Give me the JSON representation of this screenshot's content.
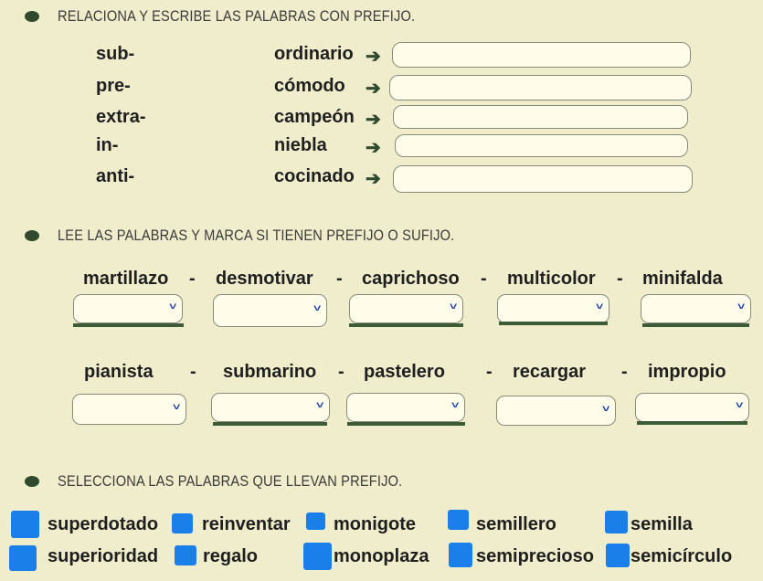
{
  "section1": {
    "heading": "RELACIONA Y ESCRIBE LAS PALABRAS CON PREFIJO.",
    "prefixes": [
      "sub-",
      "pre-",
      "extra-",
      "in-",
      "anti-"
    ],
    "words": [
      "ordinario",
      "cómodo",
      "campeón",
      "niebla",
      "cocinado"
    ],
    "arrow": "➔",
    "answers": [
      "",
      "",
      "",
      "",
      ""
    ]
  },
  "section2": {
    "heading": "LEE LAS PALABRAS Y MARCA SI TIENEN PREFIJO O SUFIJO.",
    "row1": [
      "martillazo",
      "desmotivar",
      "caprichoso",
      "multicolor",
      "minifalda"
    ],
    "row2": [
      "pianista",
      "submarino",
      "pastelero",
      "recargar",
      "impropio"
    ],
    "separator": "-",
    "chevron": "˅"
  },
  "section3": {
    "heading": "SELECCIONA LAS PALABRAS QUE LLEVAN PREFIJO.",
    "options": [
      "superdotado",
      "reinventar",
      "monigote",
      "semillero",
      "semilla",
      "superioridad",
      "regalo",
      "monoplaza",
      "semiprecioso",
      "semicírculo"
    ]
  },
  "colors": {
    "background": "#f0edcc",
    "accent": "#2f4a2c",
    "checkbox": "#1a7fe8",
    "chevron": "#1b3fae"
  }
}
